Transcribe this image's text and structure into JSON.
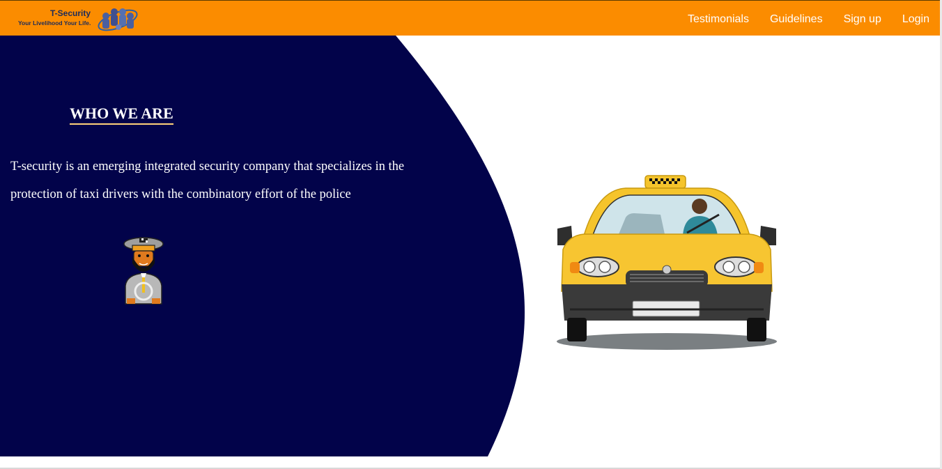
{
  "brand": {
    "name": "T-Security",
    "tagline": "Your Livelihood Your Life."
  },
  "nav": {
    "items": [
      {
        "label": "Testimonials"
      },
      {
        "label": "Guidelines"
      },
      {
        "label": "Sign up"
      },
      {
        "label": "Login"
      }
    ]
  },
  "hero": {
    "heading": "WHO WE ARE",
    "description": "T-security is an emerging integrated security company that specializes in the protection of taxi drivers with the combinatory effort of the police"
  },
  "images": {
    "logo": "security-team-logo",
    "driver": "taxi-driver-icon",
    "taxi": "taxi-car-image"
  },
  "colors": {
    "navbar": "#fb8c00",
    "hero_panel": "#02034a",
    "accent_underline": "#ffd27a",
    "taxi_body": "#f5c42c"
  }
}
